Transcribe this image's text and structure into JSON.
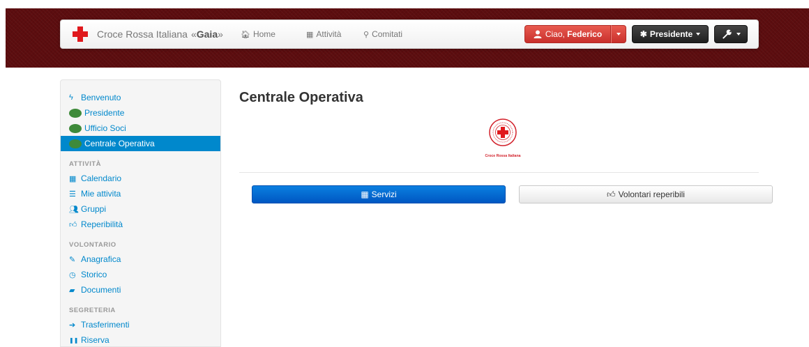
{
  "navbar": {
    "brand_name": "Croce Rossa Italiana",
    "brand_open": "«",
    "brand_app": "Gaia",
    "brand_close": "»",
    "links": [
      {
        "icon": "home-icon",
        "glyph": "🏠︎",
        "label": "Home"
      },
      {
        "icon": "calendar-icon",
        "glyph": "▦",
        "label": "Attività"
      },
      {
        "icon": "map-marker-icon",
        "glyph": "⚲",
        "label": "Comitati"
      }
    ],
    "user_greeting": "Ciao, ",
    "user_name": "Federico",
    "role_label": "Presidente",
    "role_glyph": "✱",
    "tool_glyph": "🔧︎"
  },
  "sidebar": {
    "items_top": [
      {
        "label": "Benvenuto",
        "glyph": "ϟ"
      },
      {
        "label": "Presidente"
      },
      {
        "label": "Ufficio Soci"
      },
      {
        "label": "Centrale Operativa"
      }
    ],
    "section_attivita": "ATTIVITÀ",
    "items_attivita": [
      {
        "label": "Calendario",
        "glyph": "▦"
      },
      {
        "label": "Mie attivita",
        "glyph": "☰"
      },
      {
        "label": "Gruppi",
        "glyph": "👥︎"
      },
      {
        "label": "Reperibilità",
        "glyph": "👍︎"
      }
    ],
    "section_volontario": "VOLONTARIO",
    "items_volontario": [
      {
        "label": "Anagrafica",
        "glyph": "✎"
      },
      {
        "label": "Storico",
        "glyph": "◷"
      },
      {
        "label": "Documenti",
        "glyph": "▰"
      }
    ],
    "section_segreteria": "SEGRETERIA",
    "items_segreteria": [
      {
        "label": "Trasferimenti",
        "glyph": "➔"
      },
      {
        "label": "Riserva",
        "glyph": "❚❚"
      }
    ]
  },
  "main": {
    "title": "Centrale Operativa",
    "emblem_caption": "Croce Rossa Italiana",
    "tabs": [
      {
        "label": "Servizi",
        "glyph": "▦",
        "icon": "calendar-icon"
      },
      {
        "label": "Volontari reperibili",
        "glyph": "👍︎",
        "icon": "thumbs-up-icon"
      }
    ]
  },
  "colors": {
    "banner": "#5c0d0f",
    "accent": "#0088cc",
    "danger": "#c9302c",
    "primary_tab": "#0057c2"
  }
}
